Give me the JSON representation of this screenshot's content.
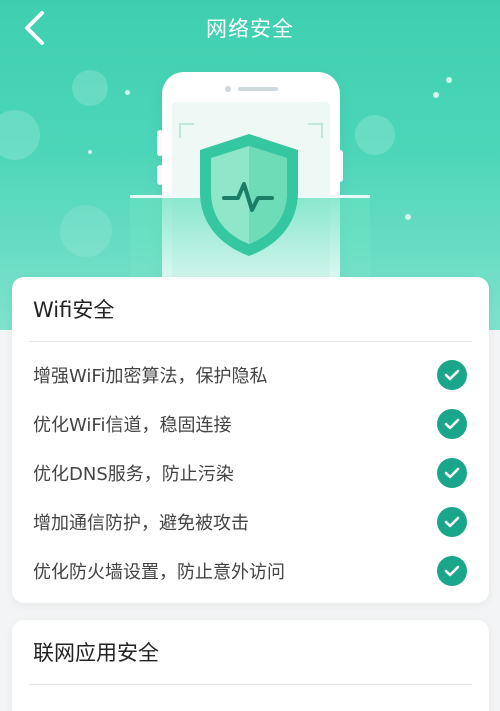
{
  "header": {
    "title": "网络安全"
  },
  "colors": {
    "accent": "#1aa68a",
    "hero_start": "#3fcfb0",
    "hero_end": "#7fe2cb"
  },
  "icons": {
    "back": "chevron-left-icon",
    "check": "check-circle-icon",
    "shield": "shield-pulse-icon"
  },
  "wifi_section": {
    "title": "Wifi安全",
    "items": [
      {
        "label": "增强WiFi加密算法，保护隐私",
        "checked": true
      },
      {
        "label": "优化WiFi信道，稳固连接",
        "checked": true
      },
      {
        "label": "优化DNS服务，防止污染",
        "checked": true
      },
      {
        "label": "增加通信防护，避免被攻击",
        "checked": true
      },
      {
        "label": "优化防火墙设置，防止意外访问",
        "checked": true
      }
    ]
  },
  "app_section": {
    "title": "联网应用安全"
  }
}
